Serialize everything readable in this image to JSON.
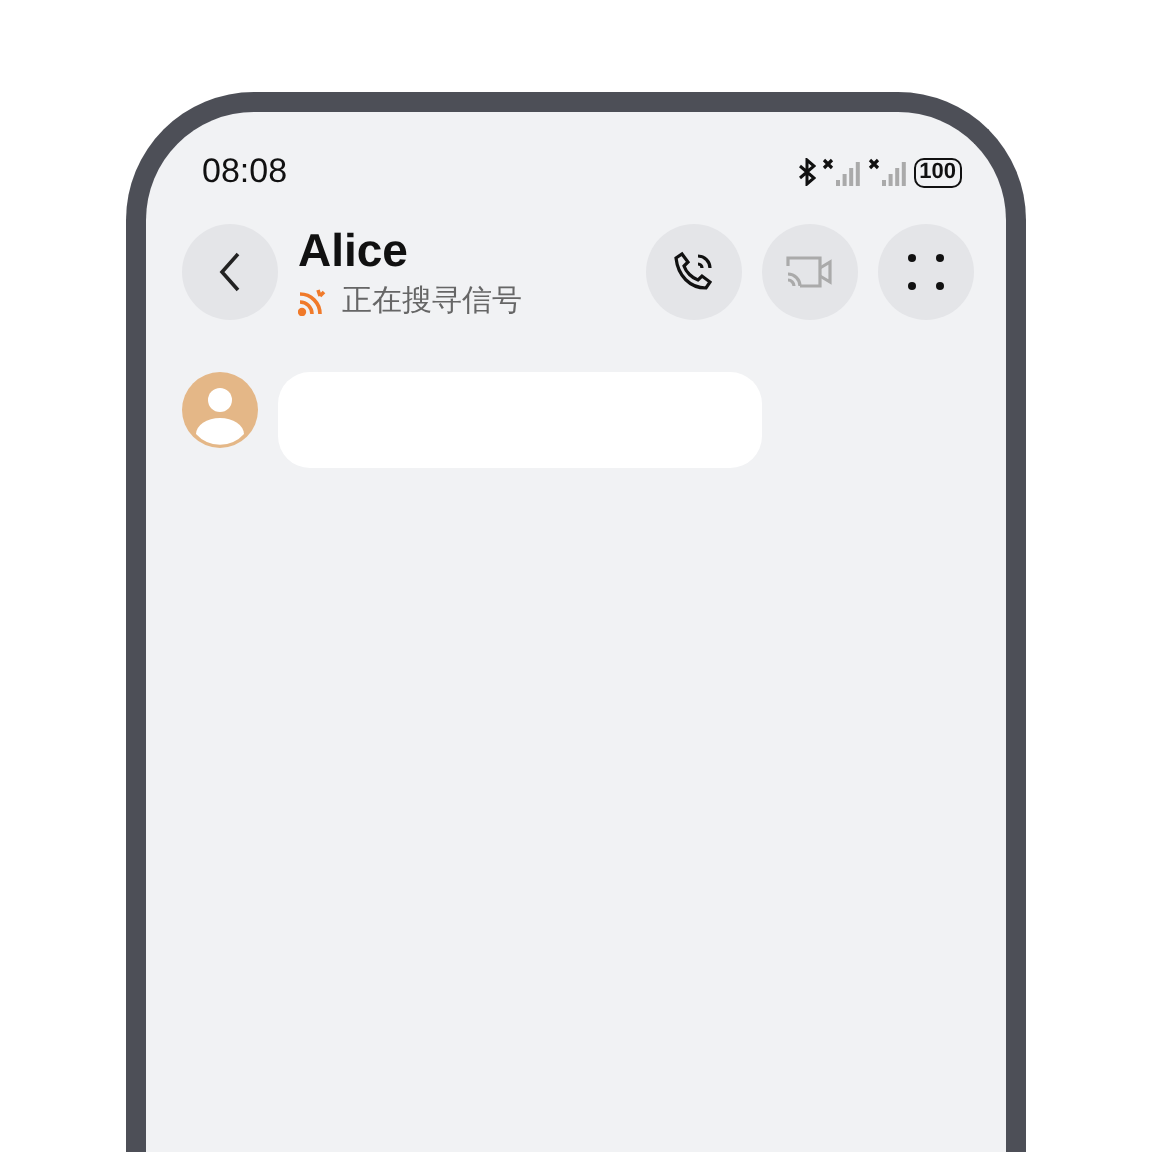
{
  "status_bar": {
    "time": "08:08",
    "battery": "100"
  },
  "header": {
    "title": "Alice",
    "subtitle": "正在搜寻信号",
    "actions": [
      {
        "kind": "call",
        "disabled": false
      },
      {
        "kind": "video",
        "disabled": true
      },
      {
        "kind": "more",
        "disabled": false
      }
    ]
  },
  "messages": [
    {
      "kind": "incoming"
    }
  ]
}
